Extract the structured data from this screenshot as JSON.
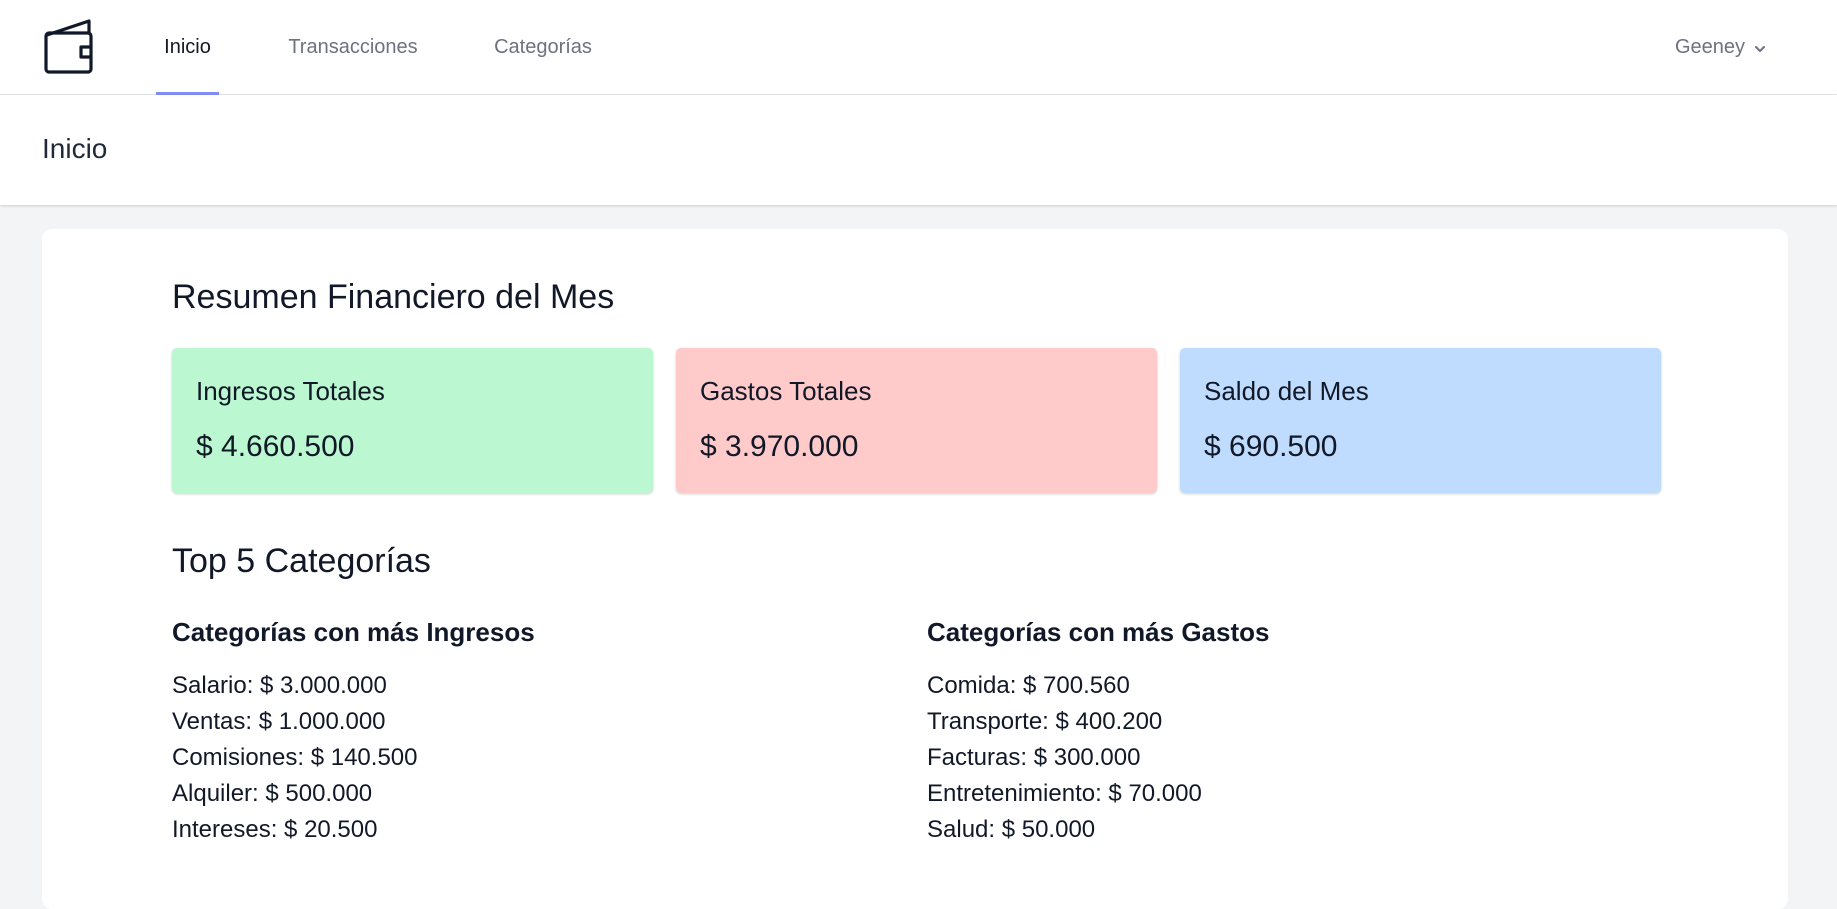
{
  "nav": {
    "links": [
      {
        "label": "Inicio",
        "active": true
      },
      {
        "label": "Transacciones",
        "active": false
      },
      {
        "label": "Categorías",
        "active": false
      }
    ],
    "user": {
      "name": "Geeney"
    }
  },
  "header": {
    "title": "Inicio"
  },
  "summary": {
    "title": "Resumen Financiero del Mes",
    "cards": [
      {
        "label": "Ingresos Totales",
        "value": "$ 4.660.500",
        "color": "#bbf7d0"
      },
      {
        "label": "Gastos Totales",
        "value": "$ 3.970.000",
        "color": "#fecaca"
      },
      {
        "label": "Saldo del Mes",
        "value": "$ 690.500",
        "color": "#bfdbfe"
      }
    ]
  },
  "top": {
    "title": "Top 5 Categorías",
    "income": {
      "title": "Categorías con más Ingresos",
      "items": [
        "Salario: $ 3.000.000",
        "Ventas: $ 1.000.000",
        "Comisiones: $ 140.500",
        "Alquiler: $ 500.000",
        "Intereses: $ 20.500"
      ]
    },
    "expenses": {
      "title": "Categorías con más Gastos",
      "items": [
        "Comida: $ 700.560",
        "Transporte: $ 400.200",
        "Facturas: $ 300.000",
        "Entretenimiento: $ 70.000",
        "Salud: $ 50.000"
      ]
    }
  },
  "icons": {
    "logo": "wallet-icon",
    "user_menu": "chevron-down-icon"
  }
}
